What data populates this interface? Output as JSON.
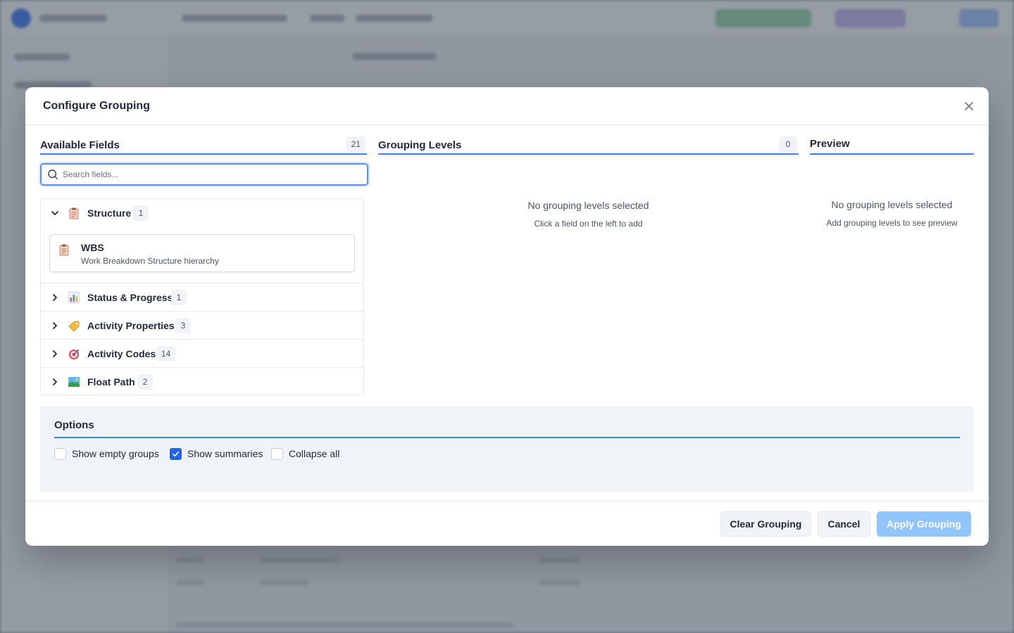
{
  "modal": {
    "title": "Configure Grouping"
  },
  "available_fields": {
    "title": "Available Fields",
    "count": "21",
    "search_placeholder": "Search fields...",
    "categories": [
      {
        "label": "Structure",
        "count": "1",
        "expanded": true,
        "icon": "clipboard-icon",
        "fields": [
          {
            "name": "WBS",
            "description": "Work Breakdown Structure hierarchy",
            "icon": "clipboard-icon"
          }
        ]
      },
      {
        "label": "Status & Progress",
        "count": "1",
        "expanded": false,
        "icon": "bar-chart-icon"
      },
      {
        "label": "Activity Properties",
        "count": "3",
        "expanded": false,
        "icon": "tag-icon"
      },
      {
        "label": "Activity Codes",
        "count": "14",
        "expanded": false,
        "icon": "target-icon"
      },
      {
        "label": "Float Path",
        "count": "2",
        "expanded": false,
        "icon": "landscape-icon"
      }
    ]
  },
  "grouping_levels": {
    "title": "Grouping Levels",
    "count": "0",
    "empty_title": "No grouping levels selected",
    "empty_subtitle": "Click a field on the left to add"
  },
  "preview": {
    "title": "Preview",
    "empty_title": "No grouping levels selected",
    "empty_subtitle": "Add grouping levels to see preview"
  },
  "options": {
    "title": "Options",
    "items": [
      {
        "label": "Show empty groups",
        "checked": false
      },
      {
        "label": "Show summaries",
        "checked": true
      },
      {
        "label": "Collapse all",
        "checked": false
      }
    ]
  },
  "footer": {
    "clear_label": "Clear Grouping",
    "cancel_label": "Cancel",
    "apply_label": "Apply Grouping"
  },
  "colors": {
    "accent": "#3b82f6",
    "primary_disabled": "#93c5fd",
    "checkbox_checked": "#2563eb"
  }
}
